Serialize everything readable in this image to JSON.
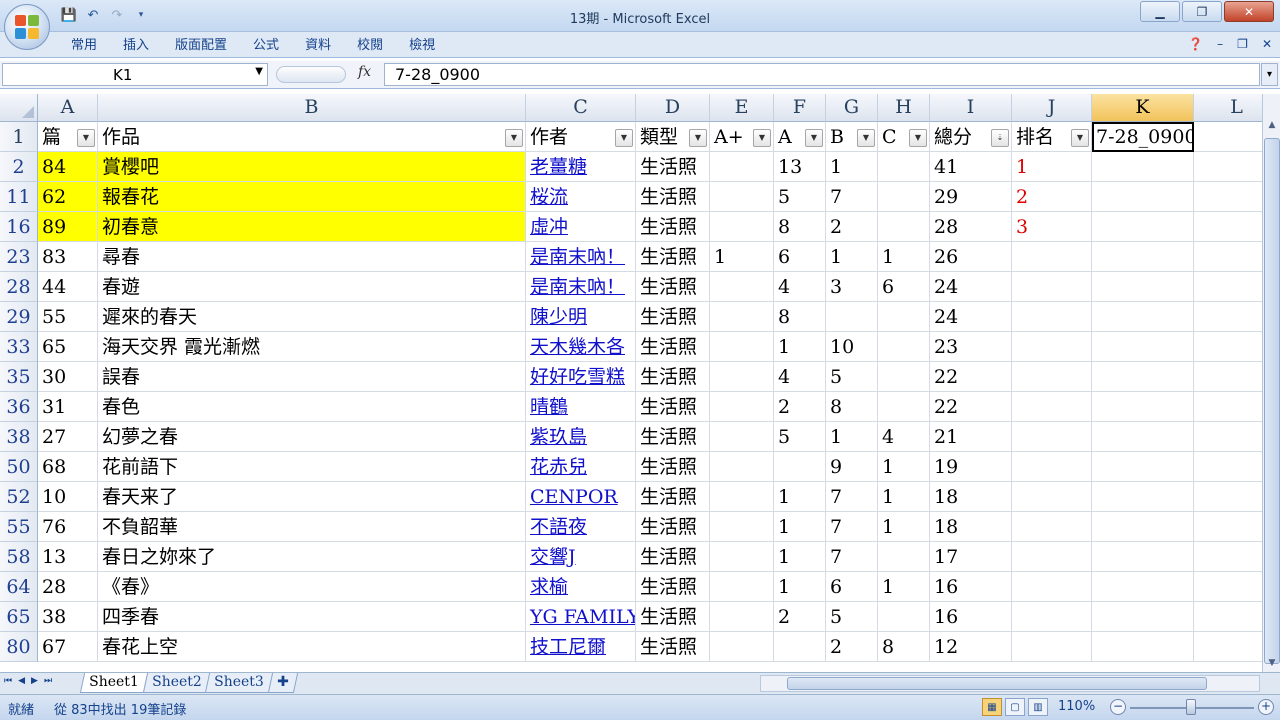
{
  "window": {
    "title": "13期 - Microsoft Excel",
    "controls": {
      "minimize": "▁",
      "restore": "❐",
      "close": "✕"
    }
  },
  "ribbon": {
    "tabs": [
      "常用",
      "插入",
      "版面配置",
      "公式",
      "資料",
      "校閱",
      "檢視"
    ],
    "help_icon": "help-icon"
  },
  "formula_bar": {
    "name_box": "K1",
    "fx": "fx",
    "value": "7-28_0900"
  },
  "columns": [
    {
      "letter": "A",
      "header": "篇"
    },
    {
      "letter": "B",
      "header": "作品"
    },
    {
      "letter": "C",
      "header": "作者"
    },
    {
      "letter": "D",
      "header": "類型"
    },
    {
      "letter": "E",
      "header": "A+"
    },
    {
      "letter": "F",
      "header": "A"
    },
    {
      "letter": "G",
      "header": "B"
    },
    {
      "letter": "H",
      "header": "C"
    },
    {
      "letter": "I",
      "header": "總分"
    },
    {
      "letter": "J",
      "header": "排名"
    },
    {
      "letter": "K",
      "header": "7-28_0900"
    },
    {
      "letter": "L",
      "header": ""
    }
  ],
  "rows": [
    {
      "num": "2",
      "cells": [
        "84",
        "賞櫻吧",
        "老薑糖",
        "生活照",
        "",
        "13",
        "1",
        "",
        "41",
        "1",
        "",
        ""
      ],
      "highlight": true
    },
    {
      "num": "11",
      "cells": [
        "62",
        "報春花",
        "桜流",
        "生活照",
        "",
        "5",
        "7",
        "",
        "29",
        "2",
        "",
        ""
      ],
      "highlight": true
    },
    {
      "num": "16",
      "cells": [
        "89",
        "初春意",
        "虛冲",
        "生活照",
        "",
        "8",
        "2",
        "",
        "28",
        "3",
        "",
        ""
      ],
      "highlight": true
    },
    {
      "num": "23",
      "cells": [
        "83",
        "尋春",
        "是南末吶！",
        "生活照",
        "1",
        "6",
        "1",
        "1",
        "26",
        "",
        "",
        ""
      ]
    },
    {
      "num": "28",
      "cells": [
        "44",
        "春遊",
        "是南末吶！",
        "生活照",
        "",
        "4",
        "3",
        "6",
        "24",
        "",
        "",
        ""
      ]
    },
    {
      "num": "29",
      "cells": [
        "55",
        "遲來的春天",
        "陳少明",
        "生活照",
        "",
        "8",
        "",
        "",
        "24",
        "",
        "",
        ""
      ]
    },
    {
      "num": "33",
      "cells": [
        "65",
        "海天交界 霞光漸燃",
        "天木幾木各",
        "生活照",
        "",
        "1",
        "10",
        "",
        "23",
        "",
        "",
        ""
      ]
    },
    {
      "num": "35",
      "cells": [
        "30",
        "誤春",
        "好好吃雪糕",
        "生活照",
        "",
        "4",
        "5",
        "",
        "22",
        "",
        "",
        ""
      ]
    },
    {
      "num": "36",
      "cells": [
        "31",
        "春色",
        "晴鶴",
        "生活照",
        "",
        "2",
        "8",
        "",
        "22",
        "",
        "",
        ""
      ]
    },
    {
      "num": "38",
      "cells": [
        "27",
        "幻夢之春",
        "紫玖島",
        "生活照",
        "",
        "5",
        "1",
        "4",
        "21",
        "",
        "",
        ""
      ]
    },
    {
      "num": "50",
      "cells": [
        "68",
        "花前語下",
        "花赤兒",
        "生活照",
        "",
        "",
        "9",
        "1",
        "19",
        "",
        "",
        ""
      ]
    },
    {
      "num": "52",
      "cells": [
        "10",
        "春天来了",
        "CENPOR",
        "生活照",
        "",
        "1",
        "7",
        "1",
        "18",
        "",
        "",
        ""
      ]
    },
    {
      "num": "55",
      "cells": [
        "76",
        "不負韶華",
        "不語夜",
        "生活照",
        "",
        "1",
        "7",
        "1",
        "18",
        "",
        "",
        ""
      ]
    },
    {
      "num": "58",
      "cells": [
        "13",
        "春日之妳來了",
        "交響J",
        "生活照",
        "",
        "1",
        "7",
        "",
        "17",
        "",
        "",
        ""
      ]
    },
    {
      "num": "64",
      "cells": [
        "28",
        "《春》",
        "求榆",
        "生活照",
        "",
        "1",
        "6",
        "1",
        "16",
        "",
        "",
        ""
      ]
    },
    {
      "num": "65",
      "cells": [
        "38",
        "四季春",
        "YG FAMILY",
        "生活照",
        "",
        "2",
        "5",
        "",
        "16",
        "",
        "",
        ""
      ]
    },
    {
      "num": "80",
      "cells": [
        "67",
        "春花上空",
        "技工尼爾",
        "生活照",
        "",
        "",
        "2",
        "8",
        "12",
        "",
        "",
        ""
      ]
    }
  ],
  "sheets": [
    "Sheet1",
    "Sheet2",
    "Sheet3"
  ],
  "status": {
    "ready": "就緒",
    "filter_info": "從 83中找出 19筆記錄",
    "zoom": "110%",
    "zoom_minus": "−",
    "zoom_plus": "+"
  },
  "colors": {
    "highlight": "#ffff00",
    "link": "#1111cc",
    "rank": "#e00000",
    "selected_header": "#f2c25b"
  }
}
